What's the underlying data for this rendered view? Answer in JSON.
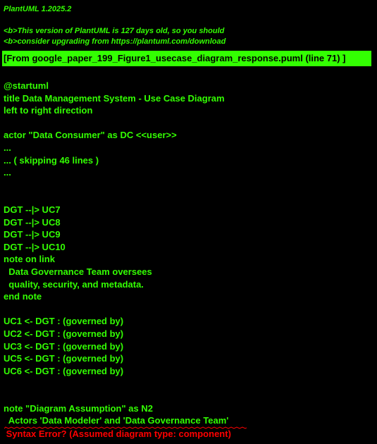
{
  "header": {
    "version": "PlantUML 1.2025.2",
    "notice_line1": "<b>This version of PlantUML is 127 days old, so you should",
    "notice_line2": "<b>consider upgrading from https://plantuml.com/download"
  },
  "banner": "[From google_paper_199_Figure1_usecase_diagram_response.puml (line 71) ]",
  "source": [
    "@startuml",
    "title Data Management System - Use Case Diagram",
    "left to right direction",
    "",
    "actor \"Data Consumer\" as DC <<user>>",
    "...",
    "... ( skipping 46 lines )",
    "...",
    "",
    "",
    "DGT --|> UC7",
    "DGT --|> UC8",
    "DGT --|> UC9",
    "DGT --|> UC10",
    "note on link",
    "  Data Governance Team oversees",
    "  quality, security, and metadata.",
    "end note",
    "",
    "UC1 <- DGT : (governed by)",
    "UC2 <- DGT : (governed by)",
    "UC3 <- DGT : (governed by)",
    "UC5 <- DGT : (governed by)",
    "UC6 <- DGT : (governed by)",
    "",
    "",
    "note \"Diagram Assumption\" as N2",
    "  Actors 'Data Modeler' and 'Data Governance Team'"
  ],
  "error": " Syntax Error? (Assumed diagram type: component)",
  "colors": {
    "background": "#000000",
    "text": "#33FF02",
    "error": "#FF0000"
  }
}
